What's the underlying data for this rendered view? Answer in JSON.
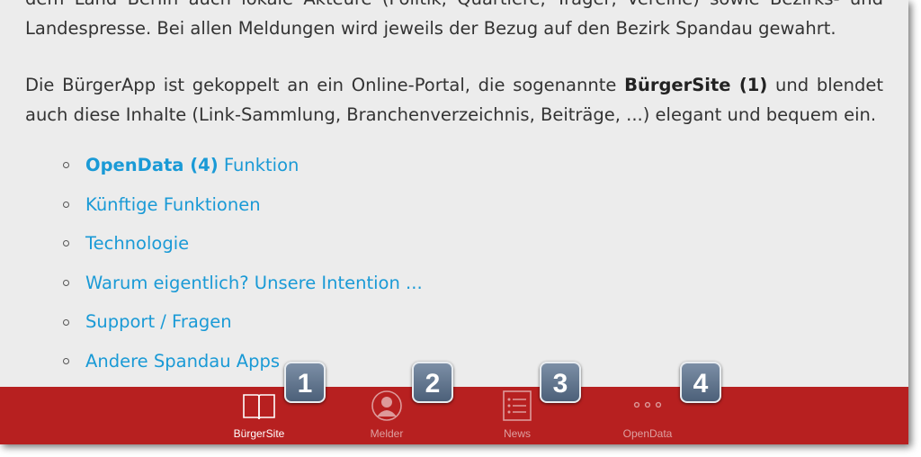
{
  "paragraphs": {
    "p1_line1": "dem Land Berlin auch lokale Akteure (Politik, Quartiere, Träger, Vereine) sowie Bezirks- und",
    "p1_line2": "Landespresse. Bei allen Meldungen wird jeweils der Bezug auf den Bezirk Spandau gewahrt.",
    "p2_pre": "Die BürgerApp ist gekoppelt an ein Online-Portal, die sogenannte ",
    "p2_bold": "BürgerSite  (1)",
    "p2_post": " und blendet",
    "p2_line2": "auch diese Inhalte (Link-Sammlung, Branchenverzeichnis, Beiträge, ...) elegant und bequem ein."
  },
  "links": [
    {
      "bold": "OpenData (4)",
      "rest": " Funktion"
    },
    {
      "bold": "",
      "rest": "Künftige Funktionen"
    },
    {
      "bold": "",
      "rest": "Technologie"
    },
    {
      "bold": "",
      "rest": "Warum eigentlich? Unsere Intention ..."
    },
    {
      "bold": "",
      "rest": "Support / Fragen"
    },
    {
      "bold": "",
      "rest": "Andere Spandau Apps"
    }
  ],
  "tabbar": {
    "tabs": [
      {
        "label": "BürgerSite",
        "icon": "book-icon",
        "active": true
      },
      {
        "label": "Melder",
        "icon": "person-icon",
        "active": false
      },
      {
        "label": "News",
        "icon": "list-icon",
        "active": false
      },
      {
        "label": "OpenData",
        "icon": "more-icon",
        "active": false
      }
    ]
  },
  "badges": [
    "1",
    "2",
    "3",
    "4"
  ],
  "colors": {
    "tabbar": "#b72020",
    "link": "#1a9ad6",
    "background": "#ececec",
    "badge": "#5e728b"
  }
}
